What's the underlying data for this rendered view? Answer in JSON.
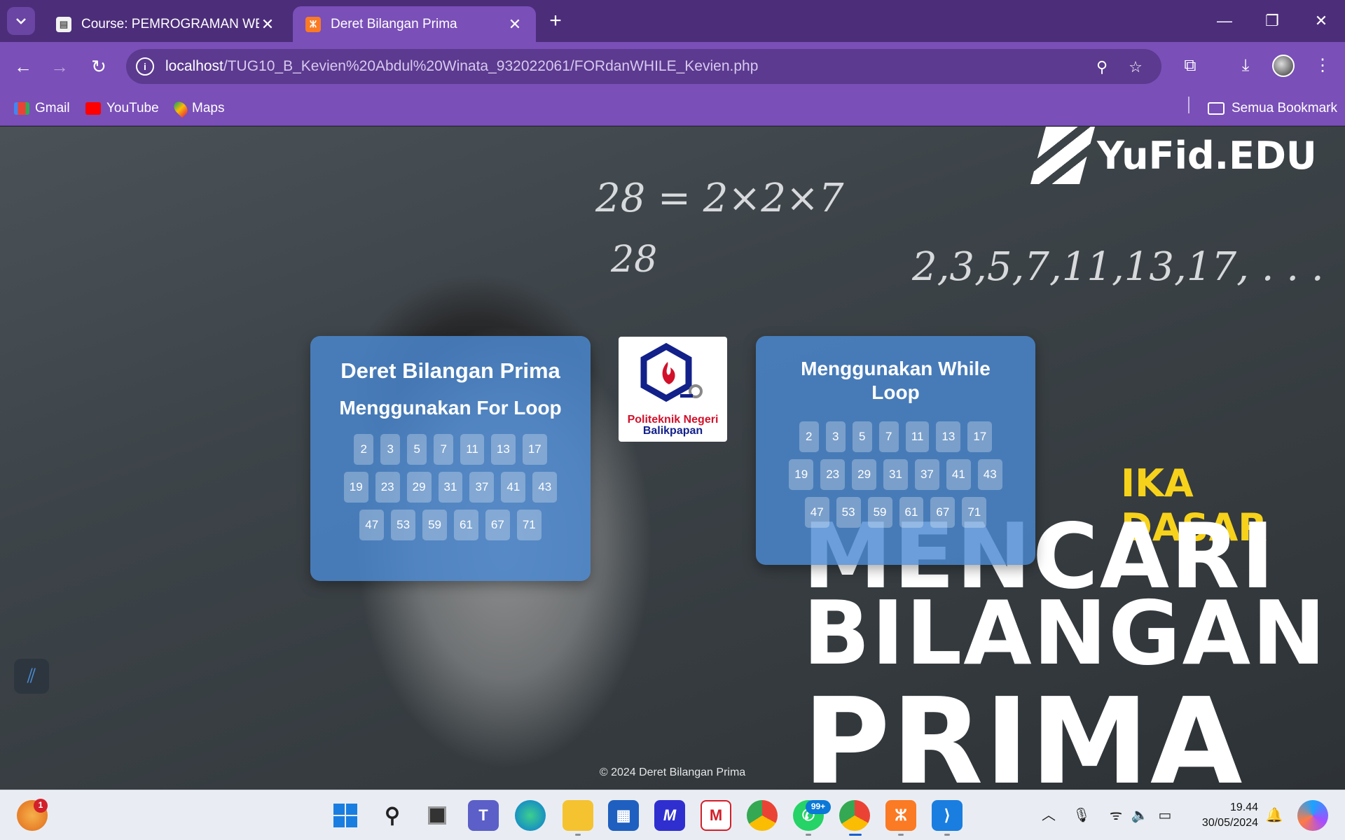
{
  "browser": {
    "tabs": [
      {
        "title": "Course: PEMROGRAMAN WEB",
        "active": false
      },
      {
        "title": "Deret Bilangan Prima",
        "active": true
      }
    ],
    "url_host": "localhost",
    "url_path": "/TUG10_B_Kevien%20Abdul%20Winata_932022061/FORdanWHILE_Kevien.php",
    "bookmarks": [
      "Gmail",
      "YouTube",
      "Maps"
    ],
    "all_bookmarks_label": "Semua Bookmark"
  },
  "background": {
    "brand": "YuFid.EDU",
    "chalk_lines": [
      "28 = 2×2×7",
      "28",
      "2,3,5,7,11,13,17, . . ."
    ],
    "poster_subtitle": "IKA DASAR",
    "poster_lines": [
      "MENCARI",
      "BILANGAN",
      "PRIMA"
    ]
  },
  "for_card": {
    "title": "Deret Bilangan Prima",
    "subtitle": "Menggunakan For Loop",
    "rows": [
      [
        "2",
        "3",
        "5",
        "7",
        "11",
        "13",
        "17"
      ],
      [
        "19",
        "23",
        "29",
        "31",
        "37",
        "41",
        "43"
      ],
      [
        "47",
        "53",
        "59",
        "61",
        "67",
        "71"
      ]
    ]
  },
  "logo": {
    "line1": "Politeknik Negeri",
    "line2": "Balikpapan"
  },
  "while_card": {
    "title": "Menggunakan While Loop",
    "rows": [
      [
        "2",
        "3",
        "5",
        "7",
        "11",
        "13",
        "17"
      ],
      [
        "19",
        "23",
        "29",
        "31",
        "37",
        "41",
        "43"
      ],
      [
        "47",
        "53",
        "59",
        "61",
        "67",
        "71"
      ]
    ]
  },
  "footer": "© 2024 Deret Bilangan Prima",
  "taskbar": {
    "notification_badge": "1",
    "whatsapp_badge": "99+",
    "time": "19.44",
    "date": "30/05/2024"
  },
  "colors": {
    "chrome_dark": "#4c2d7a",
    "chrome": "#7a4fb8",
    "card": "#4a89d2",
    "poster_yellow": "#f7d21a"
  }
}
